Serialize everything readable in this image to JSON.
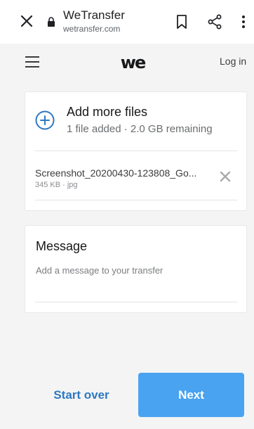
{
  "browser": {
    "title": "WeTransfer",
    "url": "wetransfer.com"
  },
  "header": {
    "logo_text": "we",
    "login_label": "Log in"
  },
  "files": {
    "add_title": "Add more files",
    "add_subtitle": "1 file added · 2.0 GB remaining",
    "items": [
      {
        "name": "Screenshot_20200430-123808_Go...",
        "meta": "345 KB · jpg"
      }
    ]
  },
  "message": {
    "title": "Message",
    "placeholder": "Add a message to your transfer"
  },
  "actions": {
    "start_over_label": "Start over",
    "next_label": "Next"
  },
  "colors": {
    "accent": "#4aa3f0",
    "link": "#2d78c2",
    "background": "#f4f4f4"
  }
}
